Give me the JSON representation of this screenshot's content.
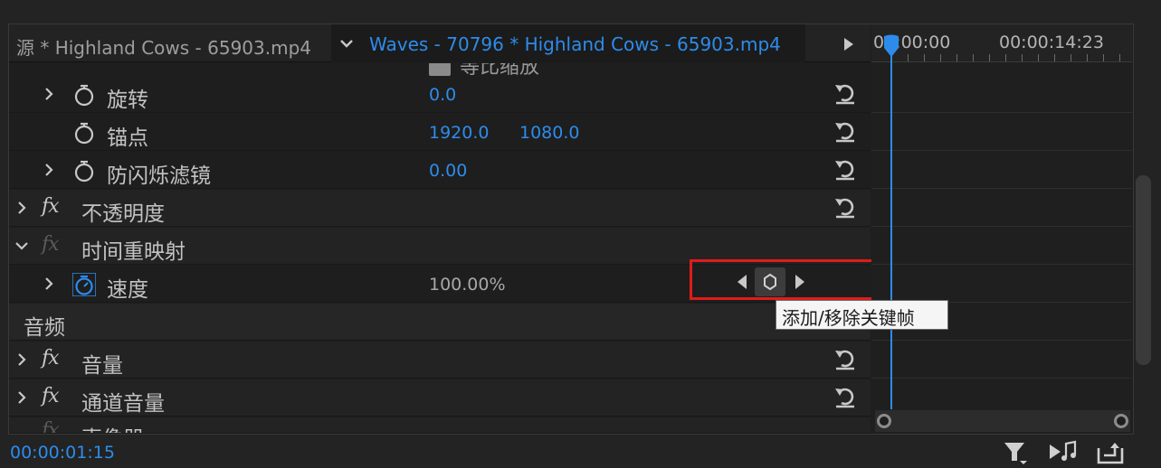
{
  "header": {
    "source_tab": "源 * Highland Cows - 65903.mp4",
    "sequence_tab": "Waves - 70796 * Highland Cows - 65903.mp4"
  },
  "cut_row": {
    "label": "等比缩放"
  },
  "rows": [
    {
      "label": "旋转",
      "value": "0.0"
    },
    {
      "label": "锚点",
      "value": "1920.0",
      "value2": "1080.0"
    },
    {
      "label": "防闪烁滤镜",
      "value": "0.00"
    },
    {
      "label": "不透明度"
    },
    {
      "label": "时间重映射"
    },
    {
      "label": "速度",
      "value": "100.00%"
    },
    {
      "label": "音频"
    },
    {
      "label": "音量"
    },
    {
      "label": "通道音量"
    },
    {
      "label": "声像器"
    }
  ],
  "tooltip": "添加/移除关键帧",
  "timeline": {
    "start_tc": "00:00:00",
    "end_tc": "00:00:14:23"
  },
  "footer": {
    "timecode": "00:00:01:15"
  },
  "icons": {
    "stopwatch": "stopwatch-icon",
    "reset": "reset-icon",
    "filter": "filter-icon",
    "play_audio": "play-audio-icon",
    "export": "export-icon"
  },
  "colors": {
    "accent": "#2d8ceb",
    "highlight": "#e01b1b"
  }
}
